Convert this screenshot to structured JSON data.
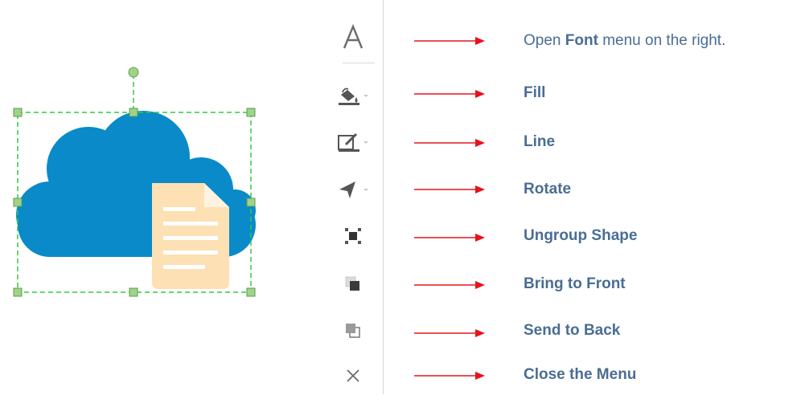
{
  "toolbar": {
    "items": [
      {
        "name": "font",
        "icon": "font-letter-a-icon"
      },
      {
        "name": "fill",
        "icon": "paint-bucket-icon",
        "has_dropdown": true
      },
      {
        "name": "line",
        "icon": "line-pen-icon",
        "has_dropdown": true
      },
      {
        "name": "rotate",
        "icon": "rotate-arrow-icon",
        "has_dropdown": true
      },
      {
        "name": "ungroup",
        "icon": "ungroup-shape-icon"
      },
      {
        "name": "bring-to-front",
        "icon": "bring-to-front-icon"
      },
      {
        "name": "send-to-back",
        "icon": "send-to-back-icon"
      },
      {
        "name": "close",
        "icon": "close-x-icon"
      }
    ]
  },
  "labels": {
    "font_prefix": "Open",
    "font_bold": "Font",
    "font_suffix": "menu on the right.",
    "fill": "Fill",
    "line": "Line",
    "rotate": "Rotate",
    "ungroup": "Ungroup Shape",
    "bring_to_front": "Bring to Front",
    "send_to_back": "Send to Back",
    "close": "Close the Menu"
  },
  "colors": {
    "cloud": "#0a8ac8",
    "document": "#fde0b4",
    "document_lines": "#ffffff",
    "selection": "#2ecc40",
    "handle": "#9fd38a",
    "arrow": "#e8121b",
    "label_text": "#4a6d93",
    "icon": "#6b6b6b"
  }
}
